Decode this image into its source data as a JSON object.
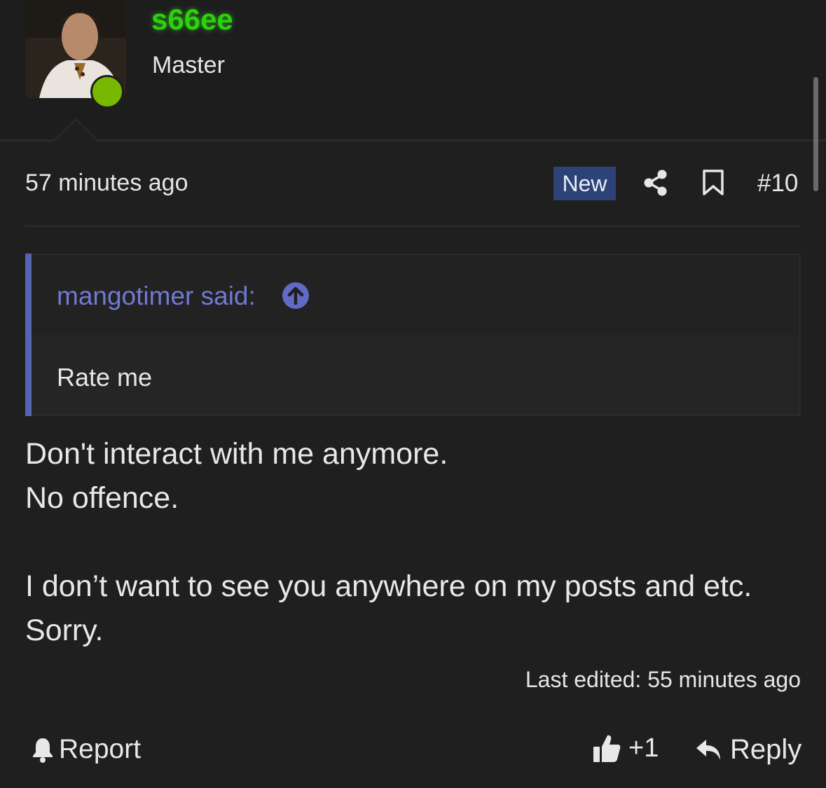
{
  "user": {
    "name": "s66ee",
    "title": "Master",
    "name_color": "#2bd30a",
    "online_color": "#78b800"
  },
  "post": {
    "timestamp": "57 minutes ago",
    "badge": "New",
    "number": "#10",
    "quote": {
      "author": "mangotimer said:",
      "text": "Rate me"
    },
    "body": [
      "Don't interact with me anymore.",
      "No offence.",
      "I don’t want to see you anywhere on my posts and etc.",
      "Sorry."
    ],
    "last_edited": "Last edited: 55 minutes ago"
  },
  "actions": {
    "report": "Report",
    "like_count": "+1",
    "reply": "Reply"
  },
  "icons": {
    "share": "share-icon",
    "bookmark": "bookmark-icon",
    "quote_jump": "arrow-up-circle-icon",
    "report": "bell-icon",
    "like": "thumbs-up-icon",
    "reply": "reply-arrow-icon"
  },
  "colors": {
    "background": "#1f1f1f",
    "badge_bg": "#2d4377",
    "quote_accent": "#5662b4",
    "quote_author": "#6f7ad2"
  }
}
